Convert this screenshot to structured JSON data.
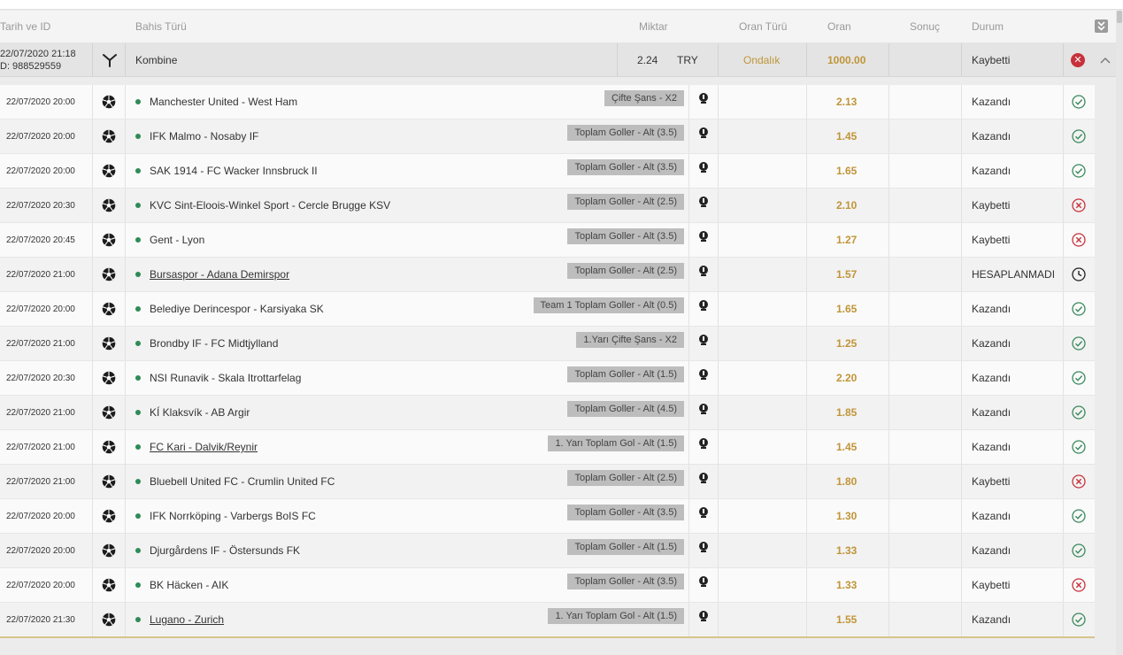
{
  "header": {
    "date_id": "Tarih ve ID",
    "bet_type": "Bahis Türü",
    "amount": "Miktar",
    "odds_type": "Oran Türü",
    "odds": "Oran",
    "result": "Sonuç",
    "status": "Durum",
    "collapse_icon": "double-chevron-down-icon"
  },
  "main": {
    "datetime": "22/07/2020 21:18",
    "id": "D: 988529559",
    "type_icon": "combo-icon",
    "bet_type": "Kombine",
    "amount": "2.24",
    "currency": "TRY",
    "odds_type": "Ondalık",
    "odds": "1000.00",
    "status": "Kaybetti",
    "status_icon": "lost-filled-icon",
    "toggle_icon": "chevron-up-icon"
  },
  "colors": {
    "accent_gold": "#c09538",
    "won_green": "#3a8a5c",
    "lost_red": "#c8313c",
    "dot_green": "#2e8b57"
  },
  "rows": [
    {
      "date": "22/07/2020 20:00",
      "match": "Manchester United - West Ham",
      "linked": false,
      "market": "Çifte Şans - X2",
      "odds": "2.13",
      "status": "Kazandı",
      "result": "won"
    },
    {
      "date": "22/07/2020 20:00",
      "match": "IFK Malmo - Nosaby IF",
      "linked": false,
      "market": "Toplam Goller - Alt (3.5)",
      "odds": "1.45",
      "status": "Kazandı",
      "result": "won"
    },
    {
      "date": "22/07/2020 20:00",
      "match": "SAK 1914 - FC Wacker Innsbruck II",
      "linked": false,
      "market": "Toplam Goller - Alt (3.5)",
      "odds": "1.65",
      "status": "Kazandı",
      "result": "won"
    },
    {
      "date": "22/07/2020 20:30",
      "match": "KVC Sint-Eloois-Winkel Sport - Cercle Brugge KSV",
      "linked": false,
      "market": "Toplam Goller - Alt (2.5)",
      "odds": "2.10",
      "status": "Kaybetti",
      "result": "lost"
    },
    {
      "date": "22/07/2020 20:45",
      "match": "Gent - Lyon",
      "linked": false,
      "market": "Toplam Goller - Alt (3.5)",
      "odds": "1.27",
      "status": "Kaybetti",
      "result": "lost"
    },
    {
      "date": "22/07/2020 21:00",
      "match": "Bursaspor - Adana Demirspor",
      "linked": true,
      "market": "Toplam Goller - Alt (2.5)",
      "odds": "1.57",
      "status": "HESAPLANMADI",
      "result": "pending"
    },
    {
      "date": "22/07/2020 20:00",
      "match": "Belediye Derincespor - Karsiyaka SK",
      "linked": false,
      "market": "Team 1 Toplam Goller - Alt (0.5)",
      "odds": "1.65",
      "status": "Kazandı",
      "result": "won"
    },
    {
      "date": "22/07/2020 21:00",
      "match": "Brondby IF - FC Midtjylland",
      "linked": false,
      "market": "1.Yarı Çifte Şans - X2",
      "odds": "1.25",
      "status": "Kazandı",
      "result": "won"
    },
    {
      "date": "22/07/2020 20:30",
      "match": "NSI Runavik - Skala Itrottarfelag",
      "linked": false,
      "market": "Toplam Goller - Alt (1.5)",
      "odds": "2.20",
      "status": "Kazandı",
      "result": "won"
    },
    {
      "date": "22/07/2020 21:00",
      "match": "KÍ Klaksvík - AB Argir",
      "linked": false,
      "market": "Toplam Goller - Alt (4.5)",
      "odds": "1.85",
      "status": "Kazandı",
      "result": "won"
    },
    {
      "date": "22/07/2020 21:00",
      "match": "FC Kari - Dalvik/Reynir",
      "linked": true,
      "market": "1. Yarı Toplam Gol - Alt (1.5)",
      "odds": "1.45",
      "status": "Kazandı",
      "result": "won"
    },
    {
      "date": "22/07/2020 21:00",
      "match": "Bluebell United FC - Crumlin United FC",
      "linked": false,
      "market": "Toplam Goller - Alt (2.5)",
      "odds": "1.80",
      "status": "Kaybetti",
      "result": "lost"
    },
    {
      "date": "22/07/2020 20:00",
      "match": "IFK Norrköping - Varbergs BoIS FC",
      "linked": false,
      "market": "Toplam Goller - Alt (3.5)",
      "odds": "1.30",
      "status": "Kazandı",
      "result": "won"
    },
    {
      "date": "22/07/2020 20:00",
      "match": "Djurgårdens IF - Östersunds FK",
      "linked": false,
      "market": "Toplam Goller - Alt (1.5)",
      "odds": "1.33",
      "status": "Kazandı",
      "result": "won"
    },
    {
      "date": "22/07/2020 20:00",
      "match": "BK Häcken - AIK",
      "linked": false,
      "market": "Toplam Goller - Alt (3.5)",
      "odds": "1.33",
      "status": "Kaybetti",
      "result": "lost"
    },
    {
      "date": "22/07/2020 21:30",
      "match": "Lugano - Zurich",
      "linked": true,
      "market": "1. Yarı Toplam Gol - Alt (1.5)",
      "odds": "1.55",
      "status": "Kazandı",
      "result": "won"
    }
  ]
}
